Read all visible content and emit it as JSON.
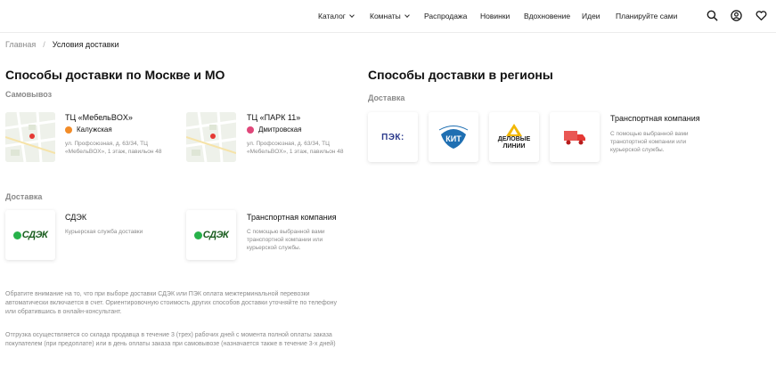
{
  "nav": {
    "items": [
      {
        "label": "Каталог",
        "dropdown": true
      },
      {
        "label": "Комнаты",
        "dropdown": true
      },
      {
        "label": "Распродажа",
        "dropdown": false
      },
      {
        "label": "Новинки",
        "dropdown": false
      },
      {
        "label": "Вдохновение",
        "dropdown": false
      },
      {
        "label": "Идеи",
        "dropdown": false
      },
      {
        "label": "Планируйте сами",
        "dropdown": false
      }
    ],
    "icons": [
      "search-icon",
      "account-icon",
      "favorites-heart-icon"
    ]
  },
  "breadcrumb": {
    "home": "Главная",
    "separator": "/",
    "current": "Условия доставки"
  },
  "moscow": {
    "title": "Способы доставки по Москве и МО",
    "pickup_label": "Самовывоз",
    "pickup_points": [
      {
        "name": "ТЦ «МебельBOX»",
        "metro": "Калужская",
        "metro_color": "#f28c28",
        "address": "ул. Профсоюзная, д. 63/34, ТЦ «МебельBOX», 1 этаж, павильон 48"
      },
      {
        "name": "ТЦ «ПАРК 11»",
        "metro": "Дмитровская",
        "metro_color": "#e0477a",
        "address": "ул. Профсоюзная, д. 63/34, ТЦ «МебельBOX», 1 этаж, павильон 48"
      }
    ],
    "delivery_label": "Доставка",
    "delivery_options": [
      {
        "logo": "СДЭК",
        "name": "СДЭК",
        "description": "Курьерская служба доставки"
      },
      {
        "logo": "СДЭК",
        "name": "Транспортная компания",
        "description": "С помощью выбранной вами транспортной компании или курьерской службы."
      }
    ],
    "notes": [
      "Обратите внимание на то, что при выборе доставки СДЭК или ПЭК оплата межтерминальной перевозки автоматически включается в счет. Ориентировочную стоимость других способов доставки уточняйте по телефону или обратившись в онлайн-консультант.",
      "Отгрузка осуществляется со склада продавца в течение 3 (трех) рабочих дней с момента полной оплаты заказа покупателем (при предоплате) или в день оплаты заказа при самовывозе (назначается также в течение 3-х дней)"
    ]
  },
  "regions": {
    "title": "Способы доставки в регионы",
    "delivery_label": "Доставка",
    "logos": [
      {
        "label": "ПЭК:",
        "icon": "pek-logo"
      },
      {
        "label": "",
        "icon": "kit-logo"
      },
      {
        "label": "ДЕЛОВЫЕ ЛИНИИ",
        "icon": "delovye-linii-logo"
      },
      {
        "label": "",
        "icon": "transport-truck-icon"
      }
    ],
    "transport": {
      "name": "Транспортная компания",
      "description": "С помощью выбранной вами транспортной компании или курьерской службы."
    }
  },
  "colors": {
    "pek_blue": "#2b3a8c",
    "cdek_green": "#27b24a",
    "dl_yellow": "#f2b705",
    "kit_blue": "#1f6fb2",
    "truck_red": "#e53935"
  }
}
